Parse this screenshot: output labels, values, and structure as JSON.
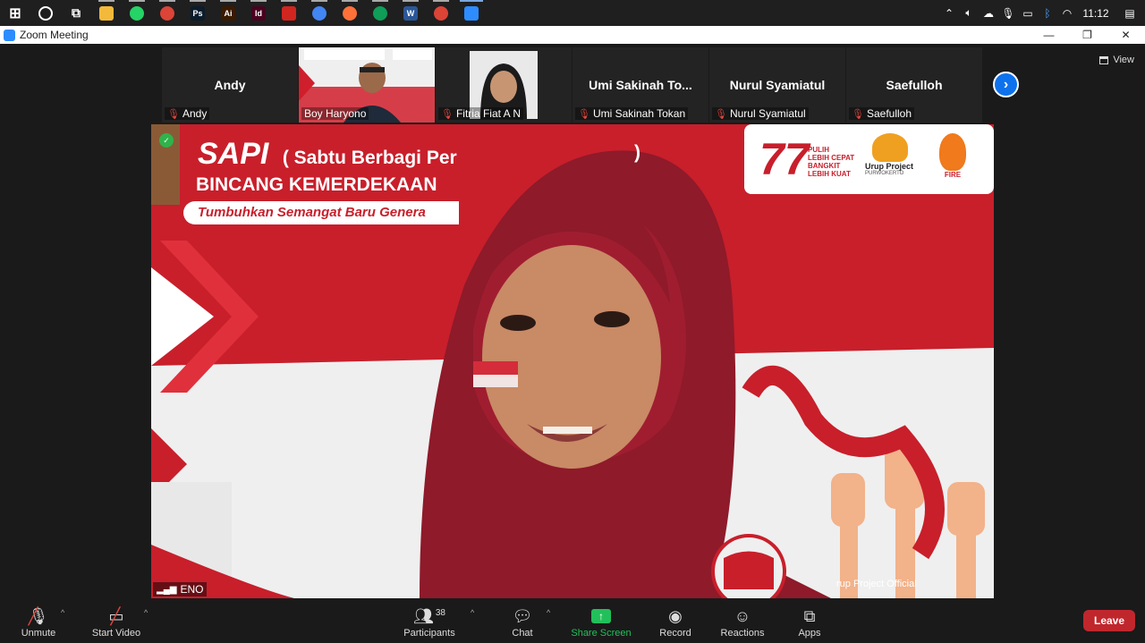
{
  "taskbar": {
    "apps": [
      {
        "name": "windows-start",
        "color": "#ffffff",
        "label": ""
      },
      {
        "name": "search",
        "color": "#ffffff",
        "label": ""
      },
      {
        "name": "task-view",
        "color": "#ffffff",
        "label": ""
      },
      {
        "name": "file-explorer",
        "color": "#f3b93a",
        "label": ""
      },
      {
        "name": "whatsapp",
        "color": "#25d366",
        "label": ""
      },
      {
        "name": "chrome",
        "color": "#db4437",
        "label": ""
      },
      {
        "name": "photoshop",
        "color": "#0b1c2c",
        "label": "Ps"
      },
      {
        "name": "illustrator",
        "color": "#3a1a00",
        "label": "Ai"
      },
      {
        "name": "indesign",
        "color": "#49021f",
        "label": "Id"
      },
      {
        "name": "acrobat",
        "color": "#d0261f",
        "label": ""
      },
      {
        "name": "chrome",
        "color": "#4285f4",
        "label": ""
      },
      {
        "name": "firefox",
        "color": "#ff7139",
        "label": ""
      },
      {
        "name": "chrome",
        "color": "#0f9d58",
        "label": ""
      },
      {
        "name": "word",
        "color": "#2b5797",
        "label": "W"
      },
      {
        "name": "chrome",
        "color": "#db4437",
        "label": ""
      },
      {
        "name": "zoom",
        "color": "#2d8cff",
        "label": ""
      }
    ],
    "clock": "11:12"
  },
  "window": {
    "title": "Zoom Meeting",
    "minimize": "—",
    "restore": "❐",
    "close": "✕"
  },
  "view_label": "View",
  "participants_strip": [
    {
      "display": "Andy",
      "label": "Andy",
      "type": "name"
    },
    {
      "display": "",
      "label": "Boy Haryono",
      "type": "video"
    },
    {
      "display": "",
      "label": "Fitria Fiat A N",
      "type": "photo"
    },
    {
      "display": "Umi Sakinah To...",
      "label": "Umi Sakinah Tokan",
      "type": "name"
    },
    {
      "display": "Nurul Syamiatul",
      "label": "Nurul Syamiatul",
      "type": "name"
    },
    {
      "display": "Saefulloh",
      "label": "Saefulloh",
      "type": "name"
    }
  ],
  "main_video": {
    "banner_title": "SAPI",
    "banner_subtitle_visible": "( Sabtu Berbagi Per",
    "banner_subtitle_end": ")",
    "banner_line2": "BINCANG KEMERDEKAAN",
    "banner_line3": "Tumbuhkan Semangat Baru Genera",
    "logo_77": "77",
    "logo_tagline": [
      "PULIH",
      "LEBIH CEPAT",
      "BANGKIT",
      "LEBIH KUAT"
    ],
    "logo_brand": "Urup Project",
    "logo_brand_sub": "PURWOKERTO",
    "logo_fire": "FIRE",
    "watermark": "rup Project Official",
    "speaker_name": "ENO",
    "colors": {
      "red": "#c81f2b",
      "white": "#f4f4f4",
      "hijab": "#8e1a2a"
    }
  },
  "toolbar": {
    "unmute": "Unmute",
    "start_video": "Start Video",
    "participants": "Participants",
    "participants_count": "38",
    "chat": "Chat",
    "share_screen": "Share Screen",
    "record": "Record",
    "reactions": "Reactions",
    "apps": "Apps",
    "leave": "Leave"
  }
}
